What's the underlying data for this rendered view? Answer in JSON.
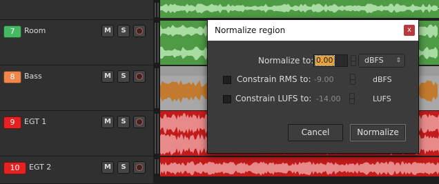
{
  "tracks": [
    {
      "number": "7",
      "name": "Room",
      "color": "#47b862"
    },
    {
      "number": "8",
      "name": "Bass",
      "color": "#f0874a"
    },
    {
      "number": "9",
      "name": "EGT 1",
      "color": "#e52222"
    },
    {
      "number": "10",
      "name": "EGT 2",
      "color": "#e52222"
    }
  ],
  "track_buttons": {
    "mute": "M",
    "solo": "S"
  },
  "region_colors": {
    "room": "#4e9a45",
    "bass": "#a8a8a8",
    "egt": "#c21b1b"
  },
  "dialog": {
    "title": "Normalize region",
    "close": "x",
    "normalize_to_label": "Normalize to:",
    "normalize_to_value": "0.00",
    "normalize_unit": "dBFS",
    "constrain_rms_label": "Constrain RMS to:",
    "constrain_rms_value": "-9.00",
    "constrain_rms_unit": "dBFS",
    "constrain_lufs_label": "Constrain LUFS to:",
    "constrain_lufs_value": "-14.00",
    "constrain_lufs_unit": "LUFS",
    "cancel": "Cancel",
    "normalize": "Normalize"
  }
}
